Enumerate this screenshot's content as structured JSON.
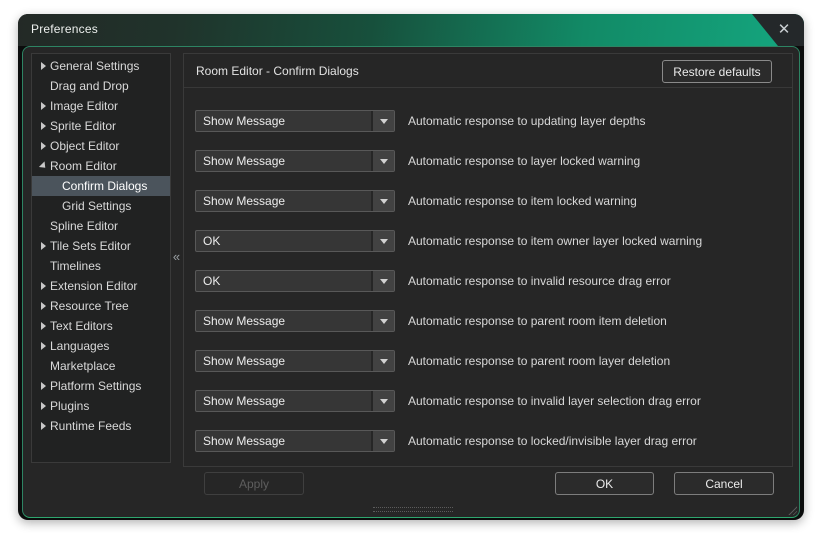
{
  "window": {
    "title": "Preferences",
    "close_icon": "✕"
  },
  "sidebar": {
    "collapse_icon": "«",
    "items": [
      {
        "label": "General Settings",
        "level": 0,
        "arrow": "collapsed",
        "selected": false
      },
      {
        "label": "Drag and Drop",
        "level": 0,
        "arrow": "none",
        "selected": false
      },
      {
        "label": "Image Editor",
        "level": 0,
        "arrow": "collapsed",
        "selected": false
      },
      {
        "label": "Sprite Editor",
        "level": 0,
        "arrow": "collapsed",
        "selected": false
      },
      {
        "label": "Object Editor",
        "level": 0,
        "arrow": "collapsed",
        "selected": false
      },
      {
        "label": "Room Editor",
        "level": 0,
        "arrow": "expanded",
        "selected": false
      },
      {
        "label": "Confirm Dialogs",
        "level": 1,
        "arrow": "none",
        "selected": true
      },
      {
        "label": "Grid Settings",
        "level": 1,
        "arrow": "none",
        "selected": false
      },
      {
        "label": "Spline Editor",
        "level": 0,
        "arrow": "none",
        "selected": false
      },
      {
        "label": "Tile Sets Editor",
        "level": 0,
        "arrow": "collapsed",
        "selected": false
      },
      {
        "label": "Timelines",
        "level": 0,
        "arrow": "none",
        "selected": false
      },
      {
        "label": "Extension Editor",
        "level": 0,
        "arrow": "collapsed",
        "selected": false
      },
      {
        "label": "Resource Tree",
        "level": 0,
        "arrow": "collapsed",
        "selected": false
      },
      {
        "label": "Text Editors",
        "level": 0,
        "arrow": "collapsed",
        "selected": false
      },
      {
        "label": "Languages",
        "level": 0,
        "arrow": "collapsed",
        "selected": false
      },
      {
        "label": "Marketplace",
        "level": 0,
        "arrow": "none",
        "selected": false
      },
      {
        "label": "Platform Settings",
        "level": 0,
        "arrow": "collapsed",
        "selected": false
      },
      {
        "label": "Plugins",
        "level": 0,
        "arrow": "collapsed",
        "selected": false
      },
      {
        "label": "Runtime Feeds",
        "level": 0,
        "arrow": "collapsed",
        "selected": false
      }
    ]
  },
  "main": {
    "header": {
      "title": "Room Editor - Confirm Dialogs",
      "restore_button": "Restore defaults"
    },
    "rows": [
      {
        "value": "Show Message",
        "label": "Automatic response to updating layer depths"
      },
      {
        "value": "Show Message",
        "label": "Automatic response to layer locked warning"
      },
      {
        "value": "Show Message",
        "label": "Automatic response to item locked warning"
      },
      {
        "value": "OK",
        "label": "Automatic response to item owner layer locked warning"
      },
      {
        "value": "OK",
        "label": "Automatic response to invalid resource drag error"
      },
      {
        "value": "Show Message",
        "label": "Automatic response to parent room item deletion"
      },
      {
        "value": "Show Message",
        "label": "Automatic response to parent room layer deletion"
      },
      {
        "value": "Show Message",
        "label": "Automatic response to invalid layer selection drag error"
      },
      {
        "value": "Show Message",
        "label": "Automatic response to locked/invisible layer drag error"
      }
    ]
  },
  "footer": {
    "apply": {
      "label": "Apply",
      "disabled": true
    },
    "ok": {
      "label": "OK"
    },
    "cancel": {
      "label": "Cancel"
    }
  },
  "colors": {
    "titlebar_gradient_left": "#232926",
    "titlebar_gradient_right": "#14a37c",
    "dialog_border_green": "#2d8463",
    "dialog_border_green_bottom": "#2ea76f",
    "selection": "#4b545c",
    "window_bg": "#0b0c0c",
    "panel_bg": "#262626",
    "sidebar_bg": "#212222",
    "dropdown_bg": "#363636"
  }
}
